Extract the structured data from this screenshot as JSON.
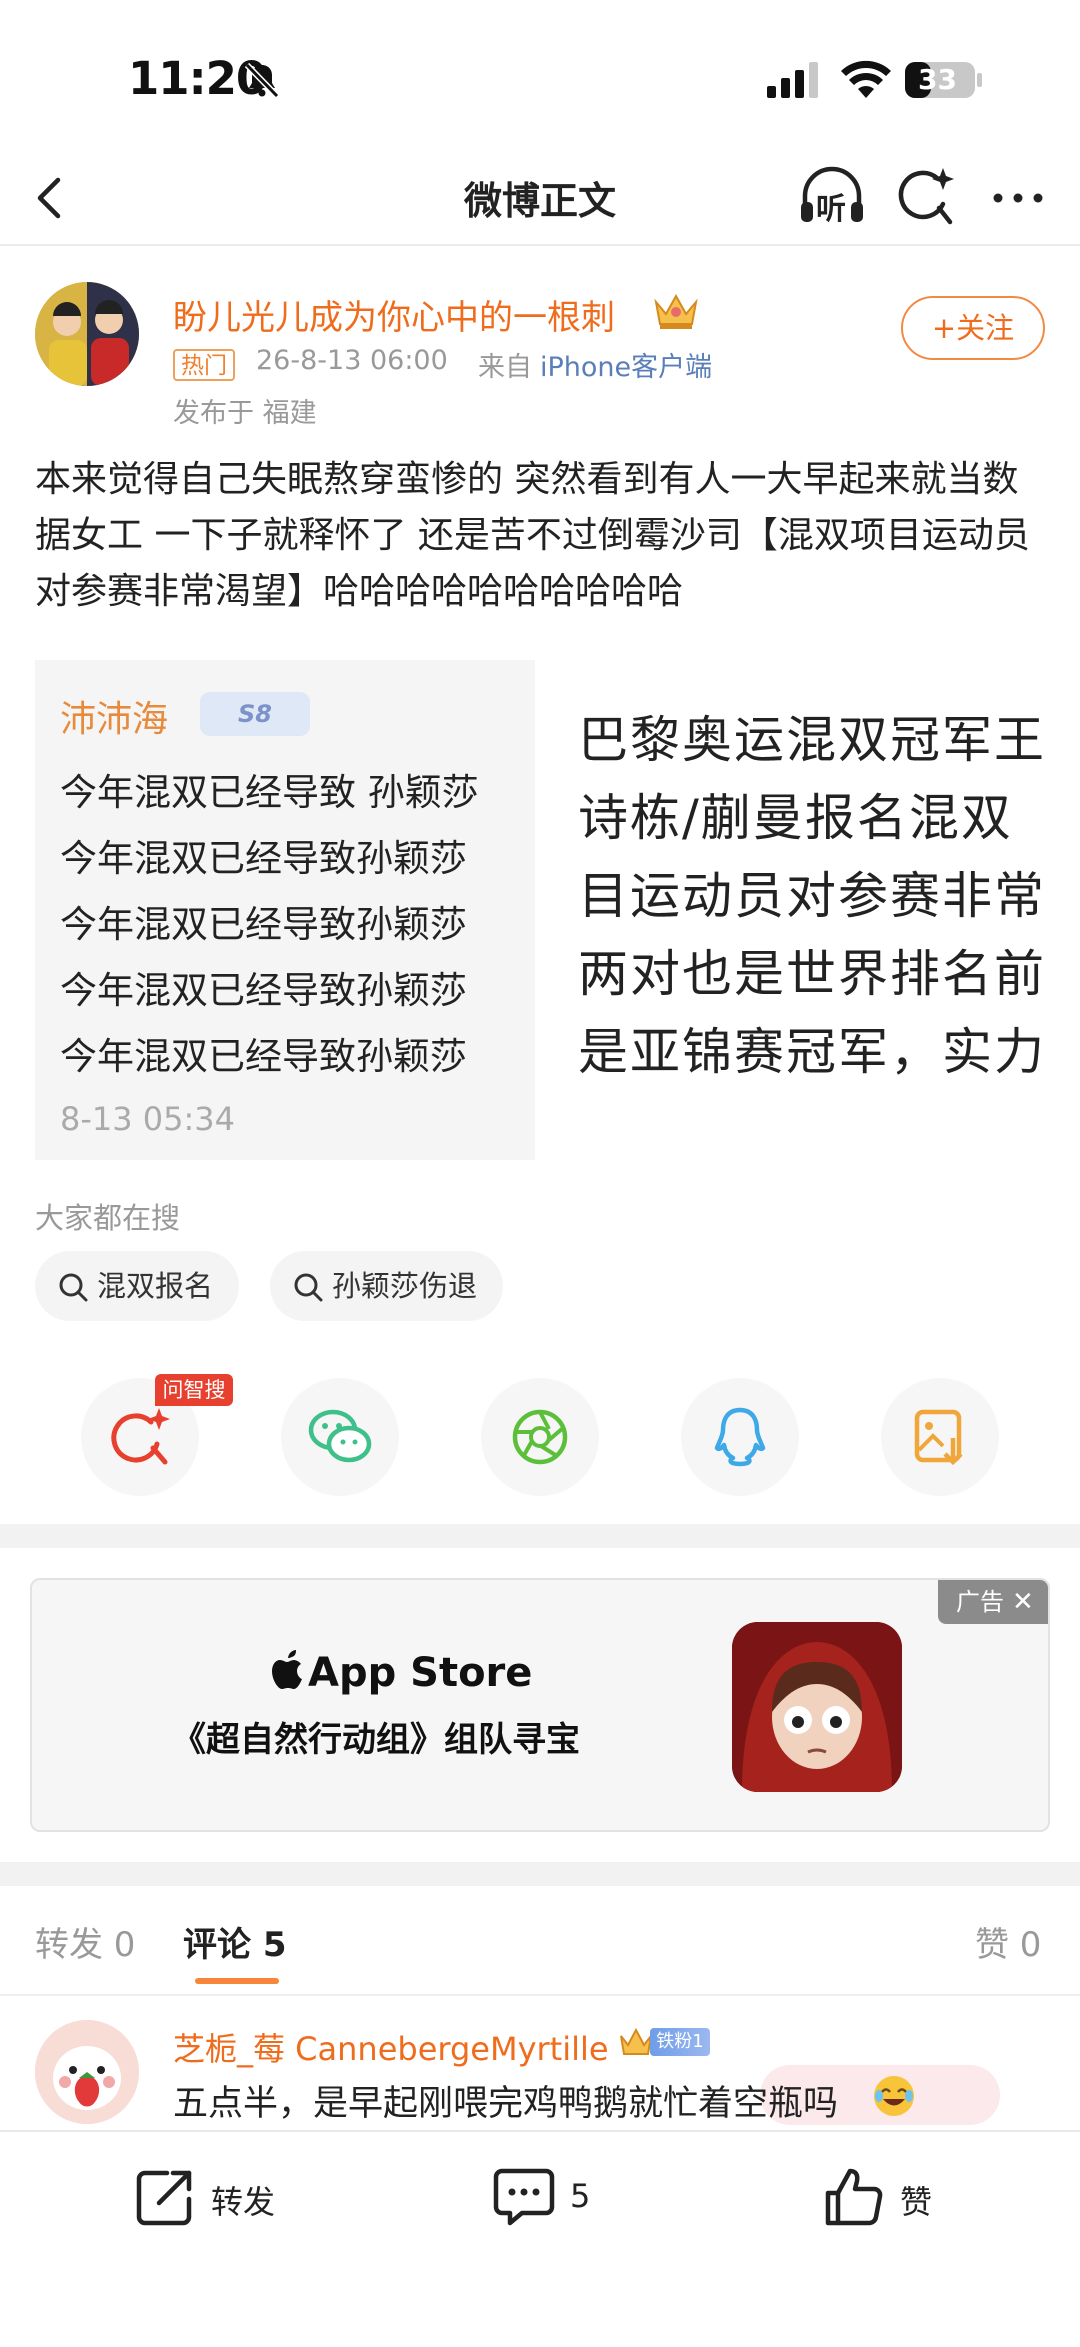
{
  "status_bar": {
    "time": "11:20",
    "battery": "33"
  },
  "nav": {
    "title": "微博正文",
    "listen_label": "听"
  },
  "post": {
    "author": "盼儿光儿成为你心中的一根刺",
    "hot_badge": "热门",
    "time": "26-8-13 06:00",
    "source_prefix": "来自",
    "source": "iPhone客户端",
    "location": "发布于 福建",
    "follow_label": "+关注",
    "text": "本来觉得自己失眠熬穿蛮惨的 突然看到有人一大早起来就当数据女工 一下子就释怀了 还是苦不过倒霉沙司【混双项目运动员对参赛非常渴望】哈哈哈哈哈哈哈哈哈哈"
  },
  "images": {
    "left": {
      "user": "沛沛海",
      "badge": "S8",
      "lines": [
        "今年混双已经导致 孙颖莎",
        "今年混双已经导致孙颖莎",
        "今年混双已经导致孙颖莎",
        "今年混双已经导致孙颖莎",
        "今年混双已经导致孙颖莎"
      ],
      "date": "8-13 05:34"
    },
    "right": {
      "lines": [
        "巴黎奥运混双冠军王",
        "诗栋/蒯曼报名混双",
        "目运动员对参赛非常",
        "两对也是世界排名前",
        "是亚锦赛冠军，实力"
      ]
    }
  },
  "trending": {
    "title": "大家都在搜",
    "chips": [
      "混双报名",
      "孙颖莎伤退"
    ]
  },
  "share": {
    "ai_tag": "问智搜",
    "icons": [
      "ai-search-icon",
      "wechat-icon",
      "moments-icon",
      "qq-icon",
      "save-image-icon"
    ]
  },
  "ad": {
    "tag": "广告",
    "brand": "App Store",
    "title": "《超自然行动组》组队寻宝"
  },
  "tabs": {
    "repost": "转发 0",
    "comment": "评论 5",
    "like": "赞 0"
  },
  "comment": {
    "user": "芝栀_莓 CannebergeMyrtille",
    "fan_badge": "铁粉1",
    "text": "五点半，是早起刚喂完鸡鸭鹅就忙着空瓶吗"
  },
  "bottom_bar": {
    "repost_label": "转发",
    "comment_count": "5",
    "like_label": "赞"
  },
  "colors": {
    "accent_orange": "#f06c1d",
    "link_blue": "#5a7fb8",
    "hot_red": "#e8402f"
  }
}
